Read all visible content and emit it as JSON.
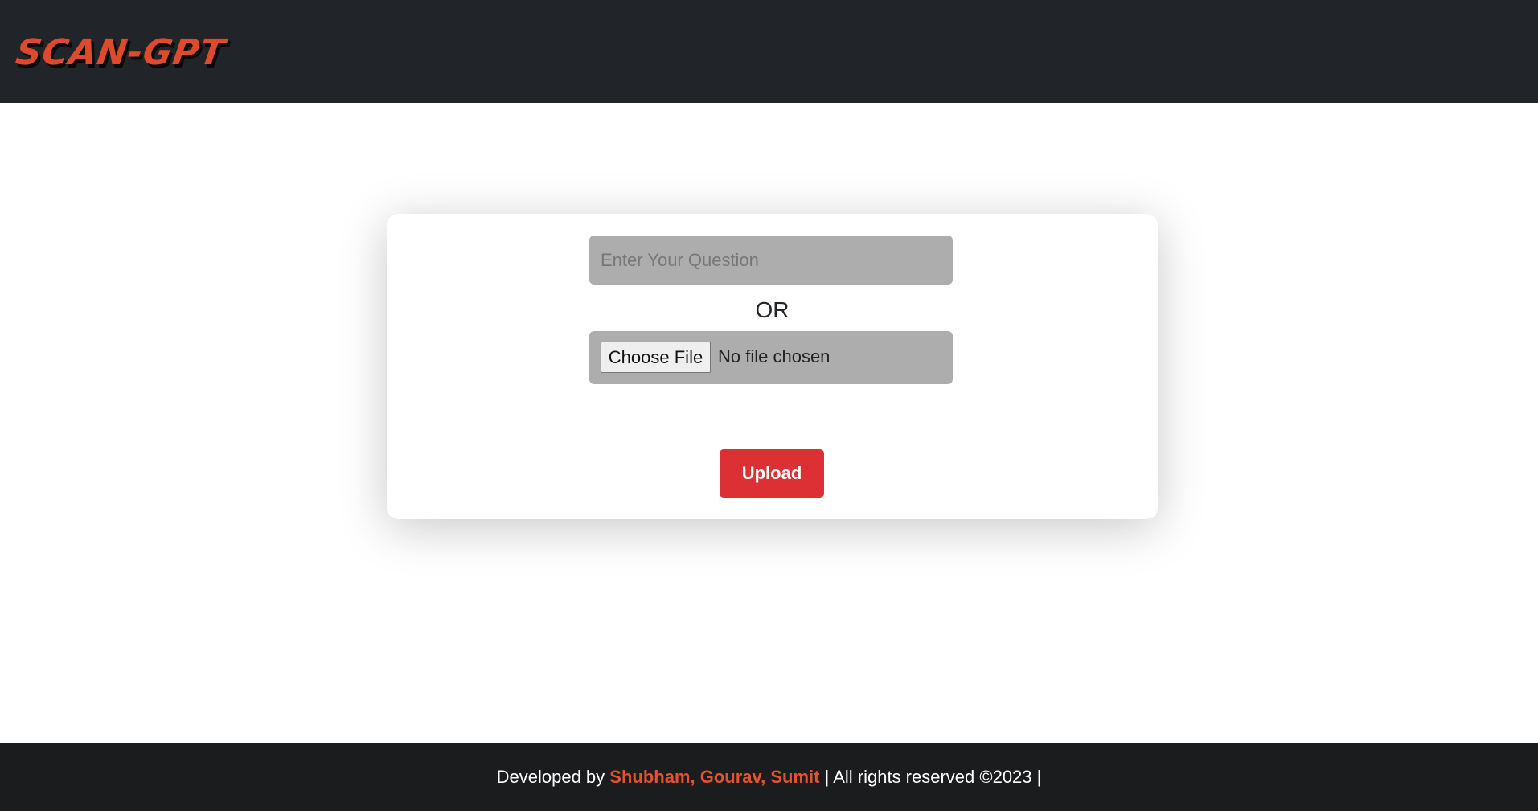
{
  "header": {
    "logo_text": "SCAN-GPT",
    "background": "#212429",
    "logo_color": "#e04a2c"
  },
  "form": {
    "question_placeholder": "Enter Your Question",
    "question_value": "",
    "or_label": "OR",
    "choose_file_label": "Choose File",
    "file_status": "No file chosen",
    "upload_label": "Upload",
    "upload_color": "#dc3034"
  },
  "footer": {
    "prefix": "Developed by ",
    "names": "Shubham, Gourav, Sumit",
    "suffix": " | All rights reserved ©2023 |",
    "names_color": "#e4532d"
  }
}
